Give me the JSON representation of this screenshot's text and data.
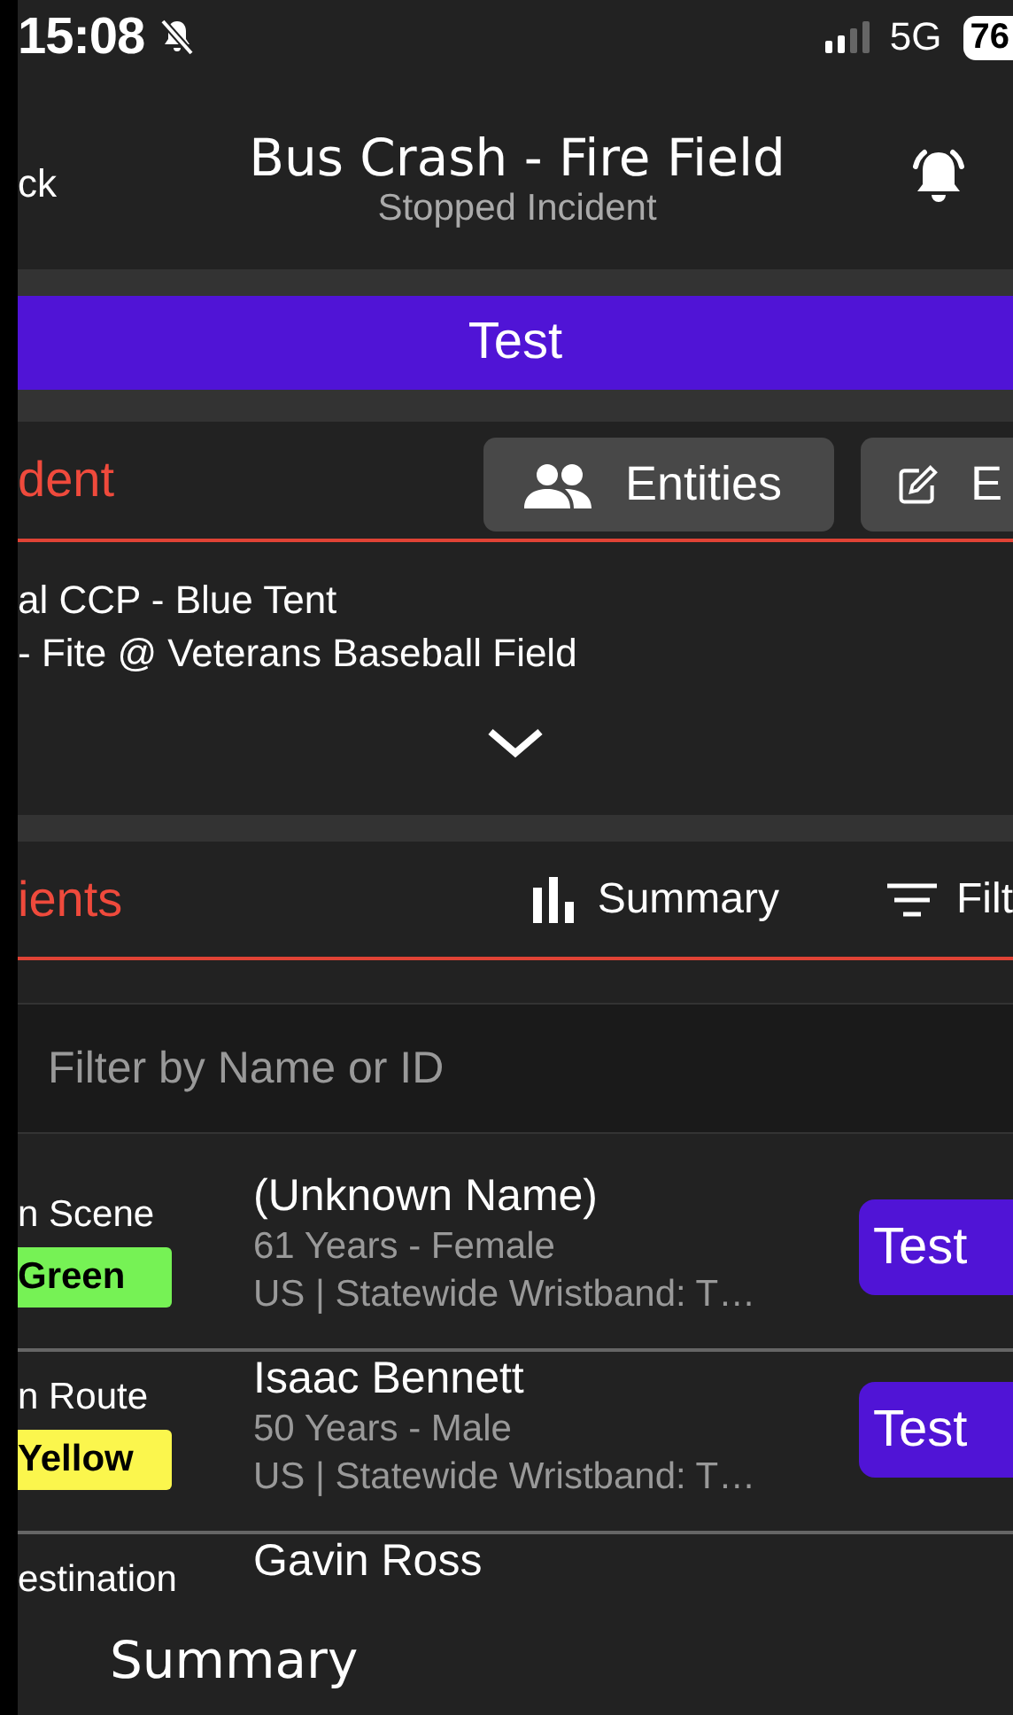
{
  "status_bar": {
    "time": "15:08",
    "network": "5G",
    "battery": "76"
  },
  "header": {
    "back": "ck",
    "title": "Bus Crash - Fire Field",
    "subtitle": "Stopped Incident"
  },
  "banner": {
    "label": "Test"
  },
  "incident": {
    "title": "dent",
    "buttons": [
      {
        "label": "Entities",
        "kind": "entities"
      },
      {
        "label": "E",
        "kind": "edit"
      }
    ],
    "lines": [
      "al CCP - Blue Tent",
      "- Fite @ Veterans Baseball Field"
    ]
  },
  "patients": {
    "title": "ients",
    "actions": [
      {
        "label": "Summary",
        "kind": "summary"
      },
      {
        "label": "Filt",
        "kind": "filter"
      }
    ],
    "search": {
      "placeholder": "Filter by Name or ID"
    },
    "rows": [
      {
        "status": "n Scene",
        "tag": "Green",
        "color": "#76f255",
        "name": "(Unknown Name)",
        "details": "61 Years - Female",
        "wristband": "US | Statewide Wristband: T…",
        "action": "Test"
      },
      {
        "status": "n Route",
        "tag": "Yellow",
        "color": "#fbf64d",
        "name": "Isaac Bennett",
        "details": "50 Years - Male",
        "wristband": "US | Statewide Wristband: T…",
        "action": "Test"
      },
      {
        "status": "estination",
        "name": "Gavin Ross"
      }
    ]
  },
  "bottom_tab": {
    "label": "Summary"
  }
}
